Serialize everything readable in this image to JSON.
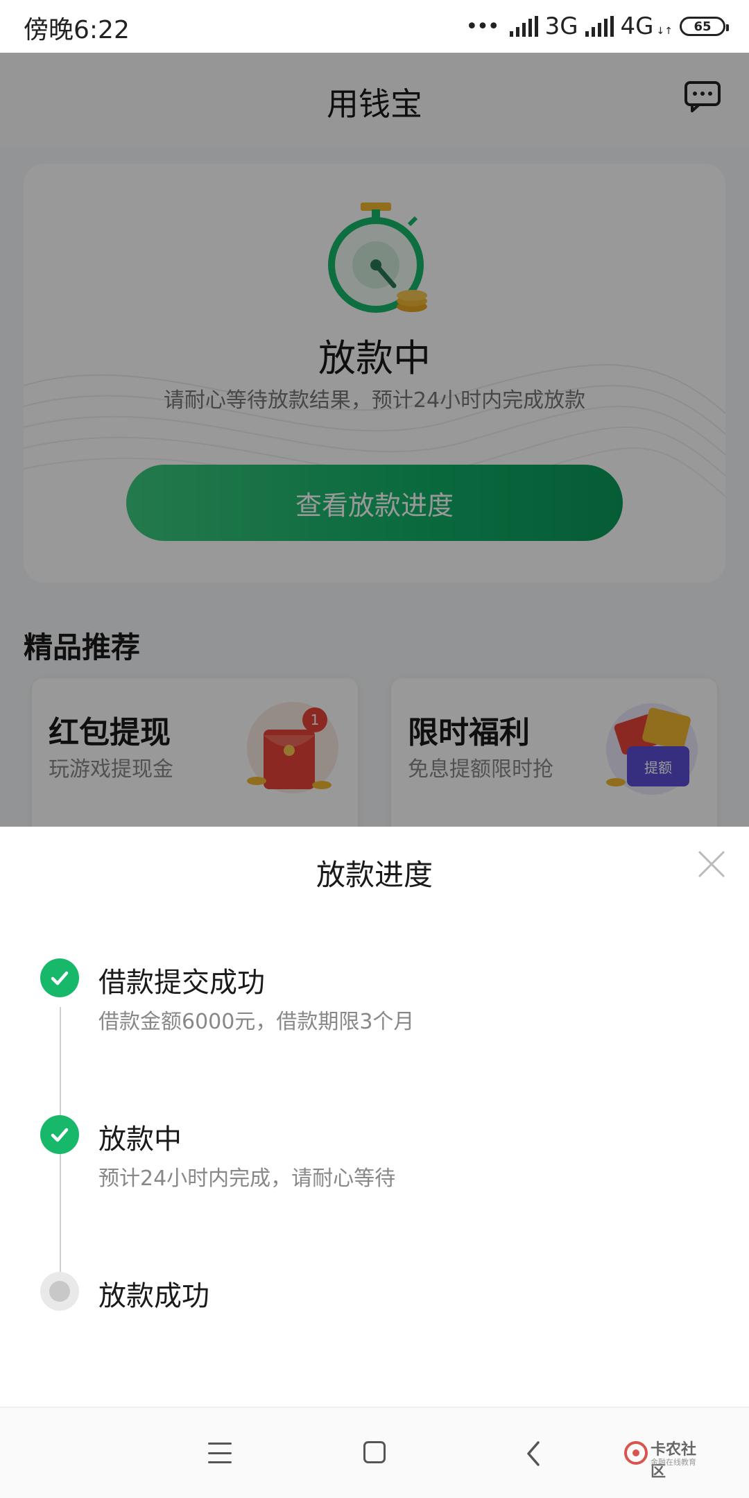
{
  "status_bar": {
    "time": "傍晚6:22",
    "network_1": "3G",
    "network_2": "4G",
    "battery": "65"
  },
  "app": {
    "title": "用钱宝",
    "status_title": "放款中",
    "status_desc": "请耐心等待放款结果，预计24小时内完成放款",
    "cta_label": "查看放款进度",
    "section_title": "精品推荐",
    "promos": [
      {
        "title": "红包提现",
        "subtitle": "玩游戏提现金",
        "badge": "1"
      },
      {
        "title": "限时福利",
        "subtitle": "免息提额限时抢",
        "tag": "提额"
      }
    ]
  },
  "sheet": {
    "title": "放款进度",
    "steps": [
      {
        "title": "借款提交成功",
        "desc": "借款金额6000元，借款期限3个月",
        "state": "done"
      },
      {
        "title": "放款中",
        "desc": "预计24小时内完成，请耐心等待",
        "state": "done"
      },
      {
        "title": "放款成功",
        "desc": "",
        "state": "pending"
      }
    ]
  },
  "watermark": {
    "text": "卡农社区",
    "sub": "金融在线教育"
  },
  "colors": {
    "accent": "#17b86a",
    "cta_start": "#3ccb7f",
    "cta_end": "#0a9a5a",
    "pending": "#c8c8c8"
  }
}
